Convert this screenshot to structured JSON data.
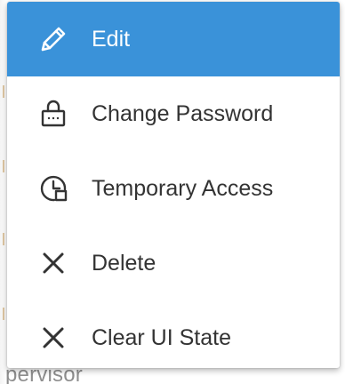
{
  "menu": {
    "items": [
      {
        "label": "Edit",
        "icon": "pencil-icon",
        "active": true
      },
      {
        "label": "Change Password",
        "icon": "lock-icon",
        "active": false
      },
      {
        "label": "Temporary Access",
        "icon": "clock-calendar-icon",
        "active": false
      },
      {
        "label": "Delete",
        "icon": "close-icon",
        "active": false
      },
      {
        "label": "Clear UI State",
        "icon": "close-icon",
        "active": false
      }
    ]
  },
  "background": {
    "partial_text": "pervisor"
  },
  "colors": {
    "active_bg": "#3a92d9",
    "active_text": "#ffffff",
    "text": "#333333"
  }
}
